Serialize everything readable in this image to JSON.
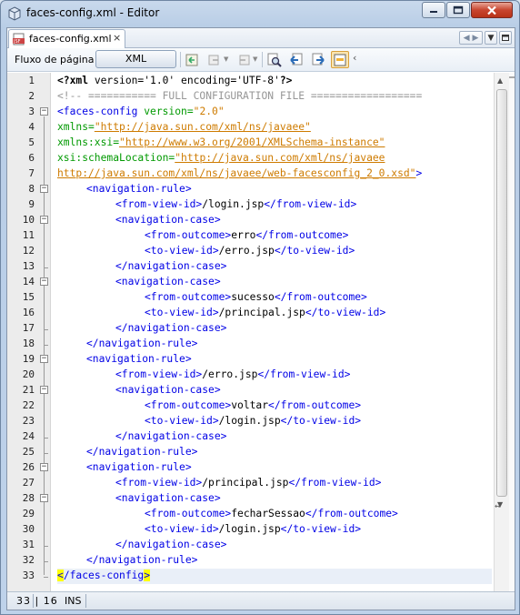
{
  "window": {
    "title": "faces-config.xml - Editor"
  },
  "tab": {
    "label": "faces-config.xml",
    "close": "×"
  },
  "toolbar": {
    "flow_label": "Fluxo de página",
    "xml_label": "XML"
  },
  "code_lines": [
    {
      "num": "1"
    },
    {
      "num": "2"
    },
    {
      "num": "3"
    },
    {
      "num": "4"
    },
    {
      "num": "5"
    },
    {
      "num": "6"
    },
    {
      "num": "7"
    },
    {
      "num": "8"
    },
    {
      "num": "9"
    },
    {
      "num": "10"
    },
    {
      "num": "11"
    },
    {
      "num": "12"
    },
    {
      "num": "13"
    },
    {
      "num": "14"
    },
    {
      "num": "15"
    },
    {
      "num": "16"
    },
    {
      "num": "17"
    },
    {
      "num": "18"
    },
    {
      "num": "19"
    },
    {
      "num": "20"
    },
    {
      "num": "21"
    },
    {
      "num": "22"
    },
    {
      "num": "23"
    },
    {
      "num": "24"
    },
    {
      "num": "25"
    },
    {
      "num": "26"
    },
    {
      "num": "27"
    },
    {
      "num": "28"
    },
    {
      "num": "29"
    },
    {
      "num": "30"
    },
    {
      "num": "31"
    },
    {
      "num": "32"
    },
    {
      "num": "33"
    }
  ],
  "code": {
    "l1": {
      "a": "<?xml ",
      "b": "version='1.0' encoding='UTF-8'",
      "c": "?>"
    },
    "l2": "<!-- =========== FULL CONFIGURATION FILE ==================",
    "l3": {
      "a": "<faces-config ",
      "b": "version=",
      "c": "\"2.0\""
    },
    "l4": {
      "a": "xmlns=",
      "b": "\"http://java.sun.com/xml/ns/javaee\""
    },
    "l5": {
      "a": "xmlns:xsi=",
      "b": "\"http://www.w3.org/2001/XMLSchema-instance\""
    },
    "l6": {
      "a": "xsi:schemaLocation=",
      "b": "\"http://java.sun.com/xml/ns/javaee"
    },
    "l7": {
      "a": "http://java.sun.com/xml/ns/javaee/web-facesconfig_2_0.xsd\"",
      "b": ">"
    },
    "l8": "<navigation-rule>",
    "l9": {
      "a": "<from-view-id>",
      "b": "/login.jsp",
      "c": "</from-view-id>"
    },
    "l10": "<navigation-case>",
    "l11": {
      "a": "<from-outcome>",
      "b": "erro",
      "c": "</from-outcome>"
    },
    "l12": {
      "a": "<to-view-id>",
      "b": "/erro.jsp",
      "c": "</to-view-id>"
    },
    "l13": "</navigation-case>",
    "l14": "<navigation-case>",
    "l15": {
      "a": "<from-outcome>",
      "b": "sucesso",
      "c": "</from-outcome>"
    },
    "l16": {
      "a": "<to-view-id>",
      "b": "/principal.jsp",
      "c": "</to-view-id>"
    },
    "l17": "</navigation-case>",
    "l18": "</navigation-rule>",
    "l19": "<navigation-rule>",
    "l20": {
      "a": "<from-view-id>",
      "b": "/erro.jsp",
      "c": "</from-view-id>"
    },
    "l21": "<navigation-case>",
    "l22": {
      "a": "<from-outcome>",
      "b": "voltar",
      "c": "</from-outcome>"
    },
    "l23": {
      "a": "<to-view-id>",
      "b": "/login.jsp",
      "c": "</to-view-id>"
    },
    "l24": "</navigation-case>",
    "l25": "</navigation-rule>",
    "l26": "<navigation-rule>",
    "l27": {
      "a": "<from-view-id>",
      "b": "/principal.jsp",
      "c": "</from-view-id>"
    },
    "l28": "<navigation-case>",
    "l29": {
      "a": "<from-outcome>",
      "b": "fecharSessao",
      "c": "</from-outcome>"
    },
    "l30": {
      "a": "<to-view-id>",
      "b": "/login.jsp",
      "c": "</to-view-id>"
    },
    "l31": "</navigation-case>",
    "l32": "</navigation-rule>",
    "l33": "</faces-config>"
  },
  "status": {
    "position": "33 | 16",
    "mode": "INS"
  },
  "colors": {
    "tag": "#0000e6",
    "attribute": "#009900",
    "value": "#ce7b00",
    "comment": "#969696",
    "bracket_highlight": "#ffff00"
  }
}
